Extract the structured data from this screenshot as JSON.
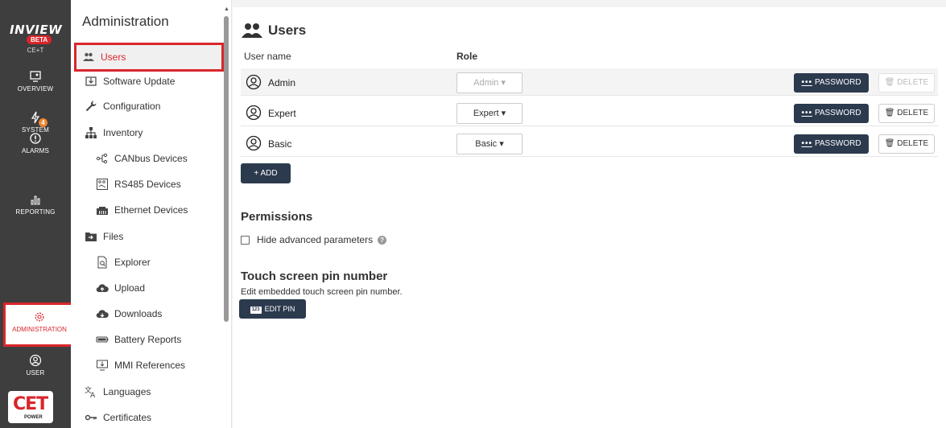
{
  "rail": {
    "logo": "INVIEW",
    "beta": "BETA",
    "model": "CE+T",
    "items": [
      {
        "label": "OVERVIEW"
      },
      {
        "label": "SYSTEM"
      },
      {
        "label": "ALARMS",
        "badge": "4"
      },
      {
        "label": "REPORTING"
      },
      {
        "label": "ADMINISTRATION"
      },
      {
        "label": "USER"
      }
    ],
    "brand": {
      "text": "CET",
      "sub": "POWER"
    }
  },
  "sidebar": {
    "title": "Administration",
    "items": [
      {
        "label": "Users"
      },
      {
        "label": "Software Update"
      },
      {
        "label": "Configuration"
      },
      {
        "label": "Inventory"
      },
      {
        "label": "CANbus Devices"
      },
      {
        "label": "RS485 Devices"
      },
      {
        "label": "Ethernet Devices"
      },
      {
        "label": "Files"
      },
      {
        "label": "Explorer"
      },
      {
        "label": "Upload"
      },
      {
        "label": "Downloads"
      },
      {
        "label": "Battery Reports"
      },
      {
        "label": "MMI References"
      },
      {
        "label": "Languages"
      },
      {
        "label": "Certificates"
      }
    ]
  },
  "main": {
    "title": "Users",
    "columns": {
      "username": "User name",
      "role": "Role"
    },
    "users": [
      {
        "name": "Admin",
        "role": "Admin ▾",
        "password": "PASSWORD",
        "delete": "DELETE"
      },
      {
        "name": "Expert",
        "role": "Expert ▾",
        "password": "PASSWORD",
        "delete": "DELETE"
      },
      {
        "name": "Basic",
        "role": "Basic ▾",
        "password": "PASSWORD",
        "delete": "DELETE"
      }
    ],
    "add_label": "+ ADD",
    "permissions": {
      "title": "Permissions",
      "checkbox_label": "Hide advanced parameters",
      "help": "?"
    },
    "pin": {
      "title": "Touch screen pin number",
      "description": "Edit embedded touch screen pin number.",
      "badge": "123",
      "button": "EDIT PIN"
    },
    "password_dots": "•••"
  },
  "colors": {
    "accent": "#d9262c",
    "button_dark": "#2c3a4e",
    "rail_bg": "#3e3e3e",
    "badge": "#f0852e"
  }
}
